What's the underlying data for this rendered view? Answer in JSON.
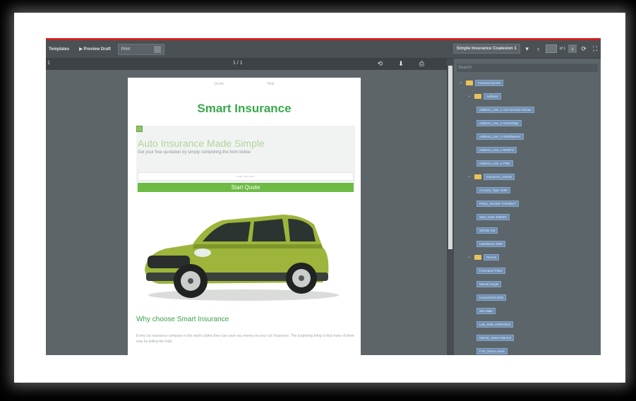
{
  "toolbar": {
    "templates": "Templates",
    "preview_draft": "▶ Preview Draft",
    "print": "Print",
    "template_select": "Simple Insurance Coalesion 1",
    "pager_text": "of 1"
  },
  "viewer": {
    "page_indicator": "1 / 1",
    "left_marker": "1"
  },
  "page": {
    "nav_left": "Quote",
    "nav_right": "Help",
    "brand": "Smart Insurance",
    "hero_title": "Auto Insurance Made Simple",
    "hero_subtitle": "Get your free quotation by simply completing the form below",
    "quote_placeholder": "enter zip code",
    "quote_button": "Start Quote",
    "why_title": "Why choose Smart Insurance",
    "body_text": "Every car insurance company in the world claims they can save you money on your car insurance. The surprising thing is that many of them may be telling the truth."
  },
  "sidebar": {
    "search_placeholder": "Search",
    "tree": [
      {
        "label": "InsuranceQuote",
        "type": "folder",
        "level": 0
      },
      {
        "label": "Address",
        "type": "folder",
        "level": 1
      },
      {
        "label": "Address_Line_1 110 Second Avenue",
        "type": "field",
        "level": 2
      },
      {
        "label": "Address_Line_2 Stoneridge",
        "type": "field",
        "level": 2
      },
      {
        "label": "Address_Line_3 Windhavens",
        "type": "field",
        "level": 2
      },
      {
        "label": "Address_Line_4 BEDFO",
        "type": "field",
        "level": 2
      },
      {
        "label": "Address_Line_5 PMS",
        "type": "field",
        "level": 2
      },
      {
        "label": "Insurance_Details",
        "type": "folder",
        "level": 1
      },
      {
        "label": "Account_Type 1099",
        "type": "field",
        "level": 2
      },
      {
        "label": "Policy_Number 22049817",
        "type": "field",
        "level": 2
      },
      {
        "label": "Start_Date 2009/07",
        "type": "field",
        "level": 2
      },
      {
        "label": "Vehicle Kia",
        "type": "field",
        "level": 2
      },
      {
        "label": "Installment 4000",
        "type": "field",
        "level": 2
      },
      {
        "label": "Person",
        "type": "folder",
        "level": 1
      },
      {
        "label": "Forename Peter",
        "type": "field",
        "level": 2
      },
      {
        "label": "Marital Single",
        "type": "field",
        "level": 2
      },
      {
        "label": "InsuredAMt 4000",
        "type": "field",
        "level": 2
      },
      {
        "label": "Sex Male",
        "type": "field",
        "level": 2
      },
      {
        "label": "Last_Date 10/05/2015",
        "type": "field",
        "level": 2
      },
      {
        "label": "Marital_Status Married",
        "type": "field",
        "level": 2
      },
      {
        "label": "First_Name Lewis",
        "type": "field",
        "level": 2
      }
    ]
  },
  "colors": {
    "brand_green": "#39a84a",
    "button_green": "#6dbb45",
    "car_green": "#9cb53a",
    "tree_label_bg": "#6f8fb1",
    "folder": "#e8c25a"
  }
}
